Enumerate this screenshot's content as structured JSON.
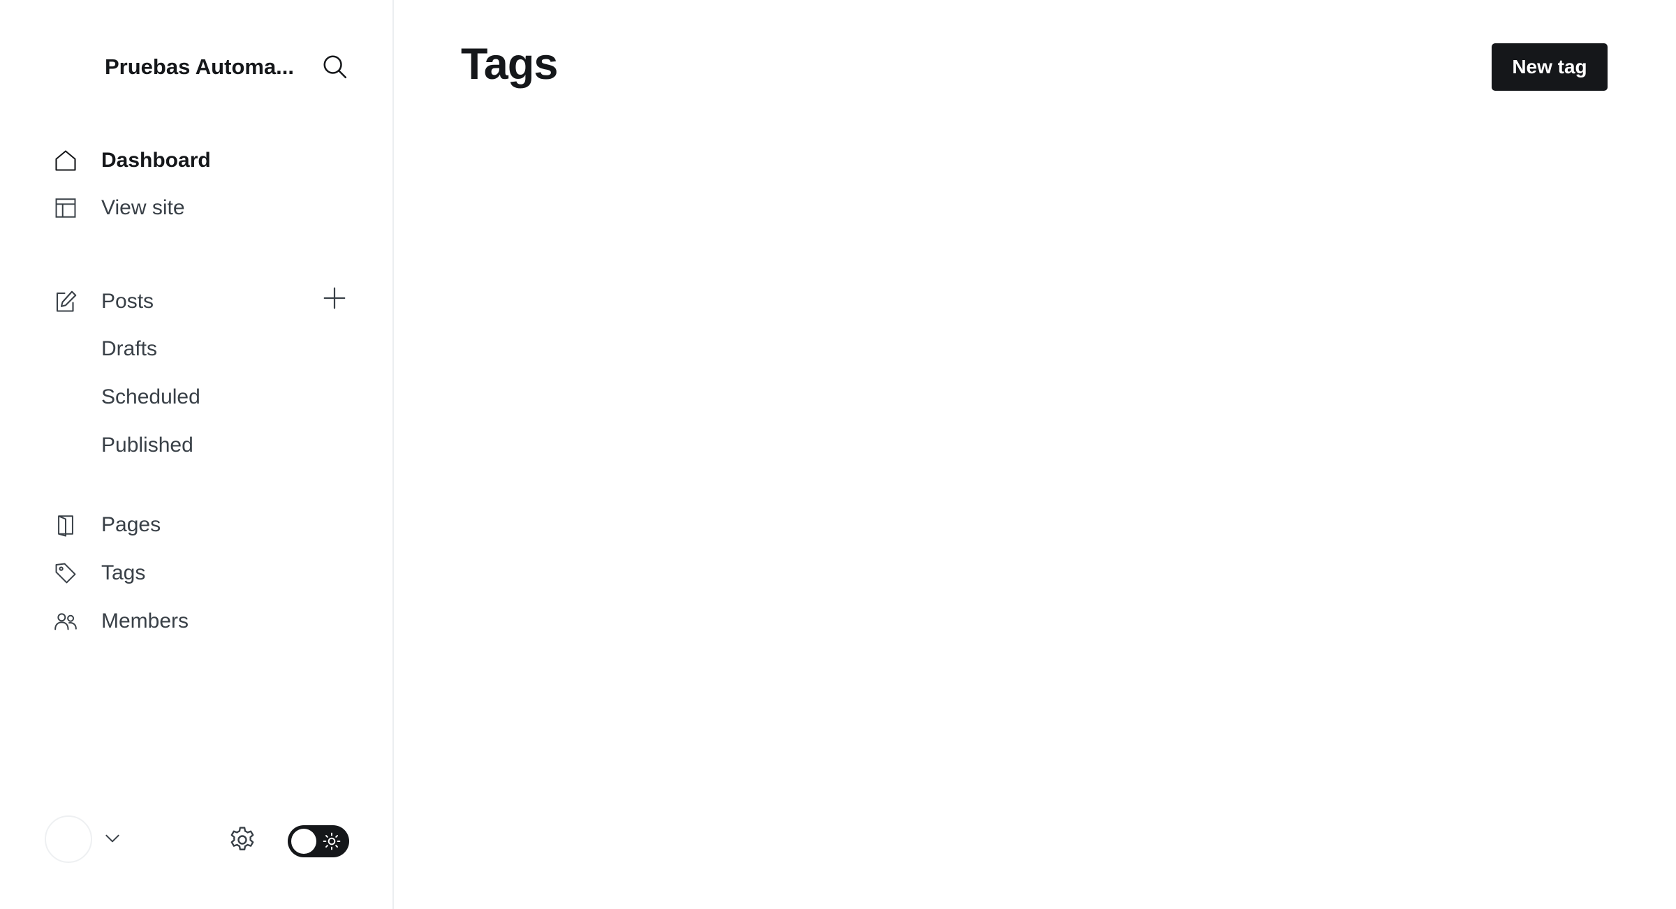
{
  "sidebar": {
    "site_title": "Pruebas Automa...",
    "nav": {
      "dashboard": {
        "label": "Dashboard",
        "icon": "home-icon"
      },
      "view_site": {
        "label": "View site",
        "icon": "layout-icon"
      },
      "posts": {
        "label": "Posts",
        "icon": "edit-icon"
      },
      "drafts": {
        "label": "Drafts"
      },
      "scheduled": {
        "label": "Scheduled"
      },
      "published": {
        "label": "Published"
      },
      "pages": {
        "label": "Pages",
        "icon": "page-icon"
      },
      "tags": {
        "label": "Tags",
        "icon": "tag-icon"
      },
      "members": {
        "label": "Members",
        "icon": "members-icon"
      }
    },
    "active_item": "Dashboard"
  },
  "main": {
    "title": "Tags",
    "new_tag_label": "New tag"
  },
  "colors": {
    "text_primary": "#15171a",
    "text_secondary": "#394047",
    "border": "#ebeef0",
    "button_bg": "#15171a"
  }
}
